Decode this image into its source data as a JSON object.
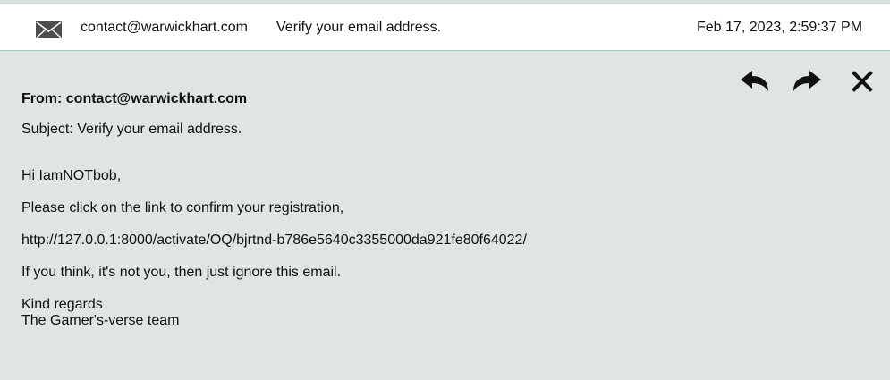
{
  "list_row": {
    "sender": "contact@warwickhart.com",
    "subject": "Verify your email address.",
    "date": "Feb 17, 2023, 2:59:37 PM",
    "icon": "envelope-icon"
  },
  "message": {
    "from_line": "From: contact@warwickhart.com",
    "subject_line": "Subject: Verify your email address.",
    "greeting": "Hi IamNOTbob,",
    "paragraph1": "Please click on the link to confirm your registration,",
    "link": "http://127.0.0.1:8000/activate/OQ/bjrtnd-b786e5640c3355000da921fe80f64022/",
    "paragraph2": "If you think, it's not you, then just ignore this email.",
    "sign_off": "Kind regards",
    "team": "The Gamer's-verse team"
  },
  "actions": {
    "reply": "reply-icon",
    "forward": "forward-icon",
    "close": "close-icon"
  },
  "colors": {
    "row_background": "#ffffff",
    "panel_background": "#dfe5e5",
    "row_border": "#aac8c0",
    "icon_gray": "#4d4d4d",
    "icon_dark": "#111111"
  }
}
